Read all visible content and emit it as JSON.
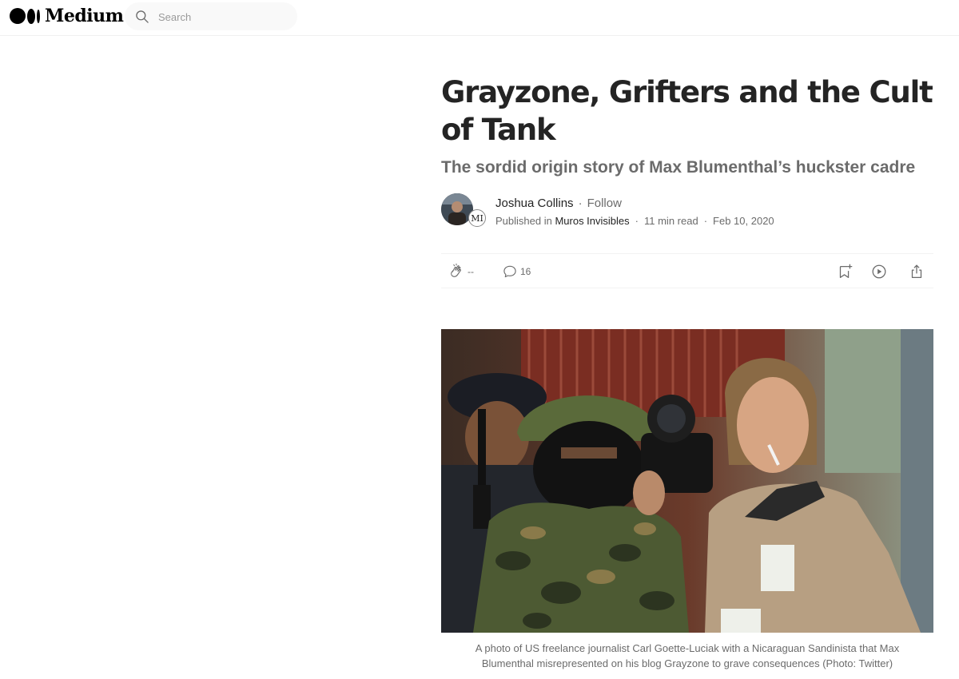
{
  "header": {
    "logo_text": "Medium",
    "search": {
      "placeholder": "Search",
      "value": ""
    },
    "icons": {
      "search": "search-icon"
    }
  },
  "article": {
    "title": "Grayzone, Grifters and the Cult of Tank",
    "subtitle": "The sordid origin story of Max Blumenthal’s huckster cadre",
    "author": {
      "name": "Joshua Collins",
      "follow_label": "Follow",
      "separator": "·"
    },
    "publication": {
      "prefix": "Published in",
      "name": "Muros Invisibles",
      "avatar_initials": "MI"
    },
    "read_time": "11 min read",
    "date": "Feb 10, 2020",
    "dot": "·",
    "actions": {
      "clap_count": "--",
      "comment_count": "16",
      "icons": [
        "clap-icon",
        "comment-icon",
        "bookmark-icon",
        "listen-icon",
        "share-icon"
      ]
    },
    "image": {
      "caption": "A photo of US freelance journalist Carl Goette-Luciak with a Nicaraguan Sandinista that Max Blumenthal misrepresented on his blog Grayzone to grave consequences (Photo: Twitter)"
    }
  },
  "colors": {
    "text_primary": "#242424",
    "text_secondary": "#6b6b6b",
    "search_bg": "#f9f9f9",
    "divider": "#f2f2f2"
  }
}
